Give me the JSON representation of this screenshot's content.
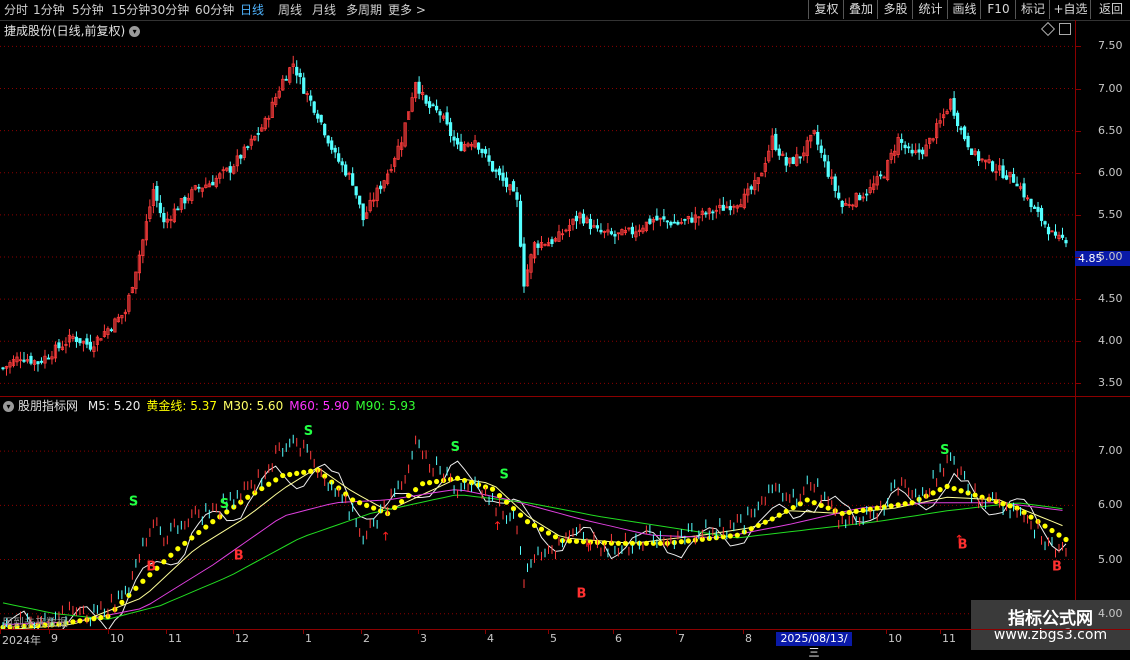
{
  "toolbar": {
    "periods": [
      "分时",
      "1分钟",
      "5分钟",
      "15分钟",
      "30分钟",
      "60分钟",
      "日线",
      "周线",
      "月线",
      "多周期",
      "更多 >"
    ],
    "active_period": "日线",
    "right_buttons": [
      "复权",
      "叠加",
      "多股",
      "统计",
      "画线",
      "F10",
      "标记",
      "+自选",
      "返回"
    ]
  },
  "main": {
    "title": "捷成股份(日线,前复权)",
    "y_ticks": [
      "7.50",
      "7.00",
      "6.50",
      "6.00",
      "5.50",
      "5.00",
      "4.50",
      "4.00",
      "3.50"
    ],
    "current_price": "4.85"
  },
  "indicator": {
    "name": "股朋指标网",
    "items": [
      {
        "label": "M5: 5.20",
        "color": "#e8e8e8"
      },
      {
        "label": "黄金线: 5.37",
        "color": "#ffff00"
      },
      {
        "label": "M30: 5.60",
        "color": "#ffff66"
      },
      {
        "label": "M60: 5.90",
        "color": "#ff33ff"
      },
      {
        "label": "M90: 5.93",
        "color": "#33ff33"
      }
    ],
    "y_ticks": [
      "7.00",
      "6.00",
      "5.00",
      "4.00"
    ],
    "signals": {
      "buy_letter": "B",
      "sell_letter": "S"
    }
  },
  "xaxis": {
    "labels": [
      "2024年",
      "9",
      "10",
      "11",
      "12",
      "1",
      "2",
      "3",
      "4",
      "5",
      "6",
      "7",
      "8",
      "10",
      "11"
    ],
    "cursor_date": "2025/08/13/三",
    "future_note": "用到未来数据"
  },
  "watermark": {
    "title": "指标公式网",
    "url": "www.zbgs3.com"
  },
  "colors": {
    "up": "#ff3c3c",
    "down": "#54ffff",
    "grid": "#8b0000",
    "gold": "#ffff00"
  },
  "chart_data": [
    {
      "type": "candlestick",
      "title": "捷成股份(日线,前复权)",
      "ylim": [
        3.35,
        7.6
      ],
      "close_path": [
        [
          0,
          3.68
        ],
        [
          5,
          3.82
        ],
        [
          10,
          3.75
        ],
        [
          15,
          3.9
        ],
        [
          20,
          4.05
        ],
        [
          25,
          3.95
        ],
        [
          30,
          4.15
        ],
        [
          35,
          4.35
        ],
        [
          40,
          5.2
        ],
        [
          43,
          5.8
        ],
        [
          46,
          5.4
        ],
        [
          50,
          5.6
        ],
        [
          55,
          5.8
        ],
        [
          60,
          5.9
        ],
        [
          65,
          6.05
        ],
        [
          70,
          6.3
        ],
        [
          75,
          6.6
        ],
        [
          80,
          7.1
        ],
        [
          83,
          7.3
        ],
        [
          86,
          7.0
        ],
        [
          90,
          6.7
        ],
        [
          95,
          6.2
        ],
        [
          100,
          5.9
        ],
        [
          103,
          5.45
        ],
        [
          106,
          5.7
        ],
        [
          110,
          6.0
        ],
        [
          114,
          6.4
        ],
        [
          118,
          7.1
        ],
        [
          121,
          6.8
        ],
        [
          125,
          6.7
        ],
        [
          130,
          6.3
        ],
        [
          135,
          6.4
        ],
        [
          140,
          6.05
        ],
        [
          145,
          5.8
        ],
        [
          147,
          5.65
        ],
        [
          149,
          4.7
        ],
        [
          152,
          5.15
        ],
        [
          158,
          5.2
        ],
        [
          165,
          5.5
        ],
        [
          170,
          5.3
        ],
        [
          175,
          5.25
        ],
        [
          180,
          5.3
        ],
        [
          186,
          5.45
        ],
        [
          193,
          5.4
        ],
        [
          200,
          5.5
        ],
        [
          207,
          5.6
        ],
        [
          212,
          5.7
        ],
        [
          216,
          5.9
        ],
        [
          220,
          6.4
        ],
        [
          224,
          6.1
        ],
        [
          228,
          6.2
        ],
        [
          232,
          6.45
        ],
        [
          236,
          6.0
        ],
        [
          240,
          5.6
        ],
        [
          244,
          5.7
        ],
        [
          248,
          5.8
        ],
        [
          252,
          6.0
        ],
        [
          256,
          6.4
        ],
        [
          260,
          6.2
        ],
        [
          264,
          6.3
        ],
        [
          268,
          6.6
        ],
        [
          271,
          6.85
        ],
        [
          274,
          6.5
        ],
        [
          278,
          6.2
        ],
        [
          282,
          6.1
        ],
        [
          286,
          6.0
        ],
        [
          290,
          5.9
        ],
        [
          294,
          5.6
        ],
        [
          298,
          5.4
        ],
        [
          301,
          5.2
        ],
        [
          304,
          5.22
        ]
      ]
    },
    {
      "type": "line",
      "title": "股朋指标网",
      "ylim": [
        3.7,
        8.0
      ],
      "series": [
        {
          "name": "黄金线",
          "last": 5.37,
          "values": [
            [
              0,
              3.75
            ],
            [
              15,
              3.8
            ],
            [
              30,
              3.95
            ],
            [
              40,
              4.6
            ],
            [
              50,
              5.2
            ],
            [
              60,
              5.7
            ],
            [
              70,
              6.15
            ],
            [
              80,
              6.55
            ],
            [
              90,
              6.65
            ],
            [
              100,
              6.1
            ],
            [
              110,
              5.85
            ],
            [
              120,
              6.4
            ],
            [
              130,
              6.5
            ],
            [
              140,
              6.3
            ],
            [
              150,
              5.7
            ],
            [
              160,
              5.35
            ],
            [
              175,
              5.3
            ],
            [
              190,
              5.3
            ],
            [
              210,
              5.45
            ],
            [
              220,
              5.75
            ],
            [
              230,
              6.1
            ],
            [
              240,
              5.85
            ],
            [
              250,
              5.95
            ],
            [
              260,
              6.05
            ],
            [
              270,
              6.35
            ],
            [
              280,
              6.15
            ],
            [
              290,
              5.95
            ],
            [
              304,
              5.37
            ]
          ]
        },
        {
          "name": "M30",
          "last": 5.6,
          "values": [
            [
              0,
              3.7
            ],
            [
              20,
              3.8
            ],
            [
              40,
              4.3
            ],
            [
              55,
              5.2
            ],
            [
              70,
              5.8
            ],
            [
              80,
              6.3
            ],
            [
              90,
              6.7
            ],
            [
              100,
              6.25
            ],
            [
              110,
              5.9
            ],
            [
              120,
              6.2
            ],
            [
              130,
              6.5
            ],
            [
              140,
              6.4
            ],
            [
              150,
              5.8
            ],
            [
              160,
              5.4
            ],
            [
              180,
              5.3
            ],
            [
              200,
              5.45
            ],
            [
              215,
              5.6
            ],
            [
              225,
              5.9
            ],
            [
              240,
              5.85
            ],
            [
              255,
              5.95
            ],
            [
              270,
              6.15
            ],
            [
              285,
              6.1
            ],
            [
              304,
              5.6
            ]
          ]
        },
        {
          "name": "M60",
          "last": 5.9,
          "values": [
            [
              0,
              3.8
            ],
            [
              20,
              3.85
            ],
            [
              40,
              4.1
            ],
            [
              60,
              4.9
            ],
            [
              80,
              5.8
            ],
            [
              95,
              6.05
            ],
            [
              110,
              6.1
            ],
            [
              130,
              6.3
            ],
            [
              145,
              6.1
            ],
            [
              165,
              5.75
            ],
            [
              185,
              5.45
            ],
            [
              205,
              5.4
            ],
            [
              225,
              5.65
            ],
            [
              245,
              5.95
            ],
            [
              265,
              6.05
            ],
            [
              285,
              6.05
            ],
            [
              304,
              5.9
            ]
          ]
        },
        {
          "name": "M90",
          "last": 5.93,
          "values": [
            [
              0,
              4.2
            ],
            [
              15,
              4.0
            ],
            [
              30,
              3.9
            ],
            [
              45,
              4.15
            ],
            [
              65,
              4.7
            ],
            [
              85,
              5.4
            ],
            [
              105,
              5.85
            ],
            [
              130,
              6.2
            ],
            [
              150,
              6.05
            ],
            [
              170,
              5.8
            ],
            [
              190,
              5.6
            ],
            [
              210,
              5.4
            ],
            [
              230,
              5.55
            ],
            [
              250,
              5.7
            ],
            [
              270,
              5.9
            ],
            [
              290,
              6.05
            ],
            [
              304,
              5.93
            ]
          ]
        }
      ]
    }
  ]
}
